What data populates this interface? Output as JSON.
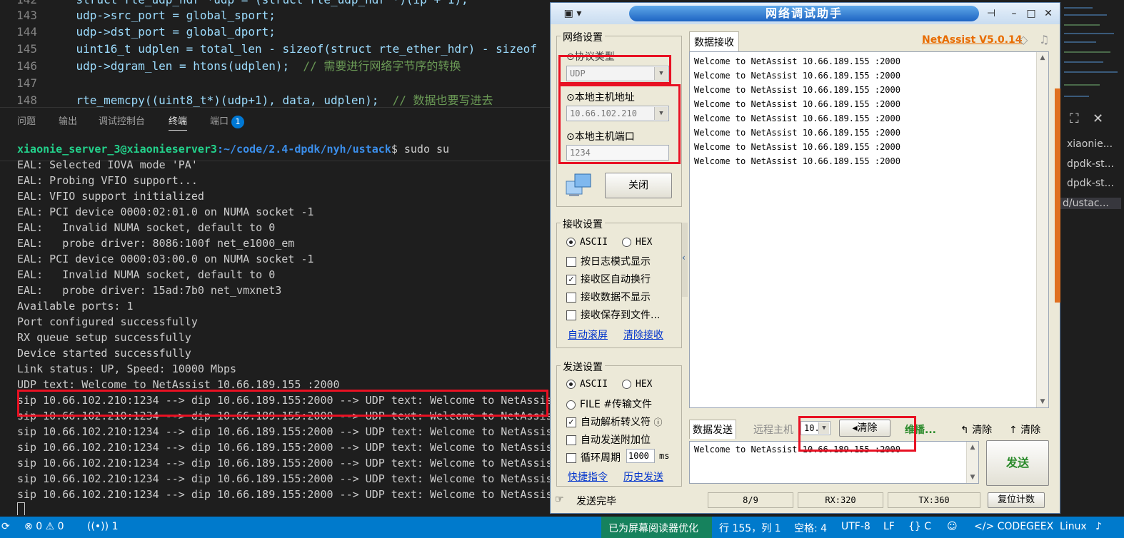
{
  "editor": {
    "lines": [
      {
        "num": "142",
        "code": "    struct rte_udp_hdr *udp = (struct rte_udp_hdr *)(ip + 1);",
        "comment": ""
      },
      {
        "num": "143",
        "code": "    udp->src_port = global_sport;",
        "comment": ""
      },
      {
        "num": "144",
        "code": "    udp->dst_port = global_dport;",
        "comment": ""
      },
      {
        "num": "145",
        "code": "    uint16_t udplen = total_len - sizeof(struct rte_ether_hdr) - sizeof",
        "comment": ""
      },
      {
        "num": "146",
        "code": "    udp->dgram_len = htons(udplen);  ",
        "comment": "// 需要进行网络字节序的转换"
      },
      {
        "num": "147",
        "code": "",
        "comment": ""
      },
      {
        "num": "148",
        "code": "    rte_memcpy((uint8_t*)(udp+1), data, udplen);  ",
        "comment": "// 数据也要写进去"
      }
    ]
  },
  "panel_tabs": [
    {
      "label": "问题"
    },
    {
      "label": "输出"
    },
    {
      "label": "调试控制台"
    },
    {
      "label": "终端"
    },
    {
      "label": "端口"
    }
  ],
  "ports_badge": "1",
  "terminal": {
    "prompt_user": "xiaonie_server_3@xiaonieserver3",
    "prompt_path": ":~/code/2.4-dpdk/nyh/ustack",
    "prompt_cmd": "$ sudo su",
    "lines": [
      "EAL: Selected IOVA mode 'PA'",
      "EAL: Probing VFIO support...",
      "EAL: VFIO support initialized",
      "EAL: PCI device 0000:02:01.0 on NUMA socket -1",
      "EAL:   Invalid NUMA socket, default to 0",
      "EAL:   probe driver: 8086:100f net_e1000_em",
      "EAL: PCI device 0000:03:00.0 on NUMA socket -1",
      "EAL:   Invalid NUMA socket, default to 0",
      "EAL:   probe driver: 15ad:7b0 net_vmxnet3",
      "Available ports: 1",
      "Port configured successfully",
      "RX queue setup successfully",
      "Device started successfully",
      "Link status: UP, Speed: 10000 Mbps",
      "UDP text: Welcome to NetAssist 10.66.189.155 :2000",
      "sip 10.66.102.210:1234 --> dip 10.66.189.155:2000 --> UDP text: Welcome to NetAssis",
      "sip 10.66.102.210:1234 --> dip 10.66.189.155:2000 --> UDP text: Welcome to NetAssis",
      "sip 10.66.102.210:1234 --> dip 10.66.189.155:2000 --> UDP text: Welcome to NetAssis",
      "sip 10.66.102.210:1234 --> dip 10.66.189.155:2000 --> UDP text: Welcome to NetAssis",
      "sip 10.66.102.210:1234 --> dip 10.66.189.155:2000 --> UDP text: Welcome to NetAssis",
      "sip 10.66.102.210:1234 --> dip 10.66.189.155:2000 --> UDP text: Welcome to NetAssis",
      "sip 10.66.102.210:1234 --> dip 10.66.189.155:2000 --> UDP text: Welcome to NetAssis"
    ]
  },
  "right_pane": {
    "items": [
      "xiaonie...",
      "dpdk-st...",
      "dpdk-st...",
      "d/ustac..."
    ]
  },
  "statusbar": {
    "errors": "0",
    "warnings": "0",
    "ports": "1",
    "screen_reader": "已为屏幕阅读器优化",
    "position": "行 155，列 1",
    "spaces": "空格: 4",
    "encoding": "UTF-8",
    "eol": "LF",
    "language": "C",
    "codegeex": "CODEGEEX",
    "platform": "Linux"
  },
  "netassist": {
    "title": "网络调试助手",
    "version": "NetAssist V5.0.14",
    "net_settings": {
      "group_title": "网络设置",
      "protocol_label": "⊙协议类型",
      "protocol_value": "UDP",
      "host_addr_label": "⊙本地主机地址",
      "host_addr_value": "10.66.102.210",
      "host_port_label": "⊙本地主机端口",
      "host_port_value": "1234",
      "close_button": "关闭"
    },
    "recv_settings": {
      "group_title": "接收设置",
      "ascii": "ASCII",
      "hex": "HEX",
      "log_mode": "按日志模式显示",
      "auto_wrap": "接收区自动换行",
      "hide_data": "接收数据不显示",
      "save_to_file": "接收保存到文件...",
      "auto_scroll": "自动滚屏",
      "clear_recv": "清除接收"
    },
    "send_settings": {
      "group_title": "发送设置",
      "ascii": "ASCII",
      "hex": "HEX",
      "file_send": "FILE #传输文件",
      "auto_escape": "自动解析转义符",
      "append_check": "自动发送附加位",
      "cycle_label": "循环周期",
      "cycle_value": "1000",
      "cycle_unit": "ms",
      "shortcuts": "快捷指令",
      "history": "历史发送"
    },
    "recv_tab": "数据接收",
    "recv_lines": [
      "Welcome to NetAssist 10.66.189.155 :2000",
      "Welcome to NetAssist 10.66.189.155 :2000",
      "Welcome to NetAssist 10.66.189.155 :2000",
      "Welcome to NetAssist 10.66.189.155 :2000",
      "Welcome to NetAssist 10.66.189.155 :2000",
      "Welcome to NetAssist 10.66.189.155 :2000",
      "Welcome to NetAssist 10.66.189.155 :2000",
      "Welcome to NetAssist 10.66.189.155 :2000"
    ],
    "send_tab": "数据发送",
    "remote_host_label": "远程主机",
    "remote_host_value": "10.",
    "clear_remote_button": "清除",
    "ellipsis_label": "维播...",
    "clear_button_1": "清除",
    "clear_button_2": "清除",
    "send_text": "Welcome to NetAssist 10.66.189.155 :2000",
    "send_button": "发送",
    "status": {
      "message": "发送完毕",
      "count": "8/9",
      "rx": "RX:320",
      "tx": "TX:360",
      "reset": "复位计数"
    }
  }
}
